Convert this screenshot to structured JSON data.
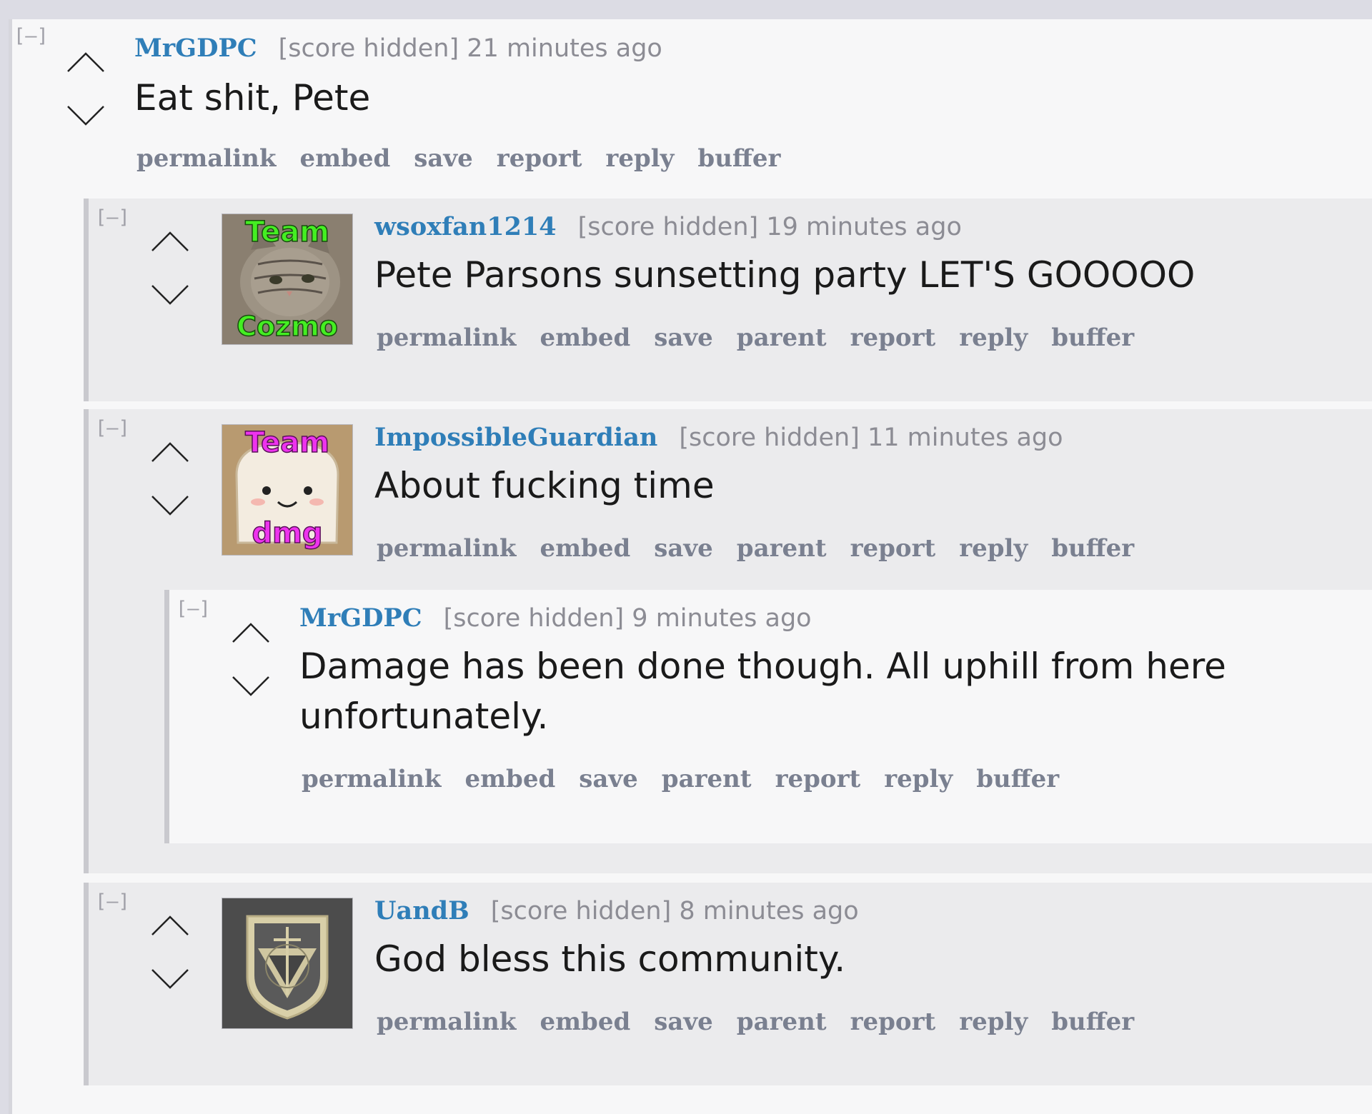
{
  "collapse_symbol": "[–]",
  "colors": {
    "author": "#2f7eb8",
    "meta": "#8c8c94",
    "action": "#7a8090",
    "body_text": "#1a1a1a",
    "team_cozmo_text": "#44ee22",
    "team_dmg_text": "#ee33ee"
  },
  "comments": [
    {
      "author": "MrGDPC",
      "score": "[score hidden]",
      "time": "21 minutes ago",
      "body": "Eat shit, Pete",
      "actions": [
        "permalink",
        "embed",
        "save",
        "report",
        "reply",
        "buffer"
      ]
    },
    {
      "author": "wsoxfan1214",
      "score": "[score hidden]",
      "time": "19 minutes ago",
      "body": "Pete Parsons sunsetting party LET'S GOOOOO",
      "avatar": {
        "icon": "cat-avatar",
        "text_top": "Team",
        "text_bottom": "Cozmo"
      },
      "actions": [
        "permalink",
        "embed",
        "save",
        "parent",
        "report",
        "reply",
        "buffer"
      ]
    },
    {
      "author": "ImpossibleGuardian",
      "score": "[score hidden]",
      "time": "11 minutes ago",
      "body": "About fucking time",
      "avatar": {
        "icon": "bread-avatar",
        "text_top": "Team",
        "text_bottom": "dmg"
      },
      "actions": [
        "permalink",
        "embed",
        "save",
        "parent",
        "report",
        "reply",
        "buffer"
      ]
    },
    {
      "author": "MrGDPC",
      "score": "[score hidden]",
      "time": "9 minutes ago",
      "body": "Damage has been done though. All uphill from here unfortunately.",
      "actions": [
        "permalink",
        "embed",
        "save",
        "parent",
        "report",
        "reply",
        "buffer"
      ]
    },
    {
      "author": "UandB",
      "score": "[score hidden]",
      "time": "8 minutes ago",
      "body": "God bless this community.",
      "avatar": {
        "icon": "shield-emblem-avatar"
      },
      "actions": [
        "permalink",
        "embed",
        "save",
        "parent",
        "report",
        "reply",
        "buffer"
      ]
    }
  ]
}
